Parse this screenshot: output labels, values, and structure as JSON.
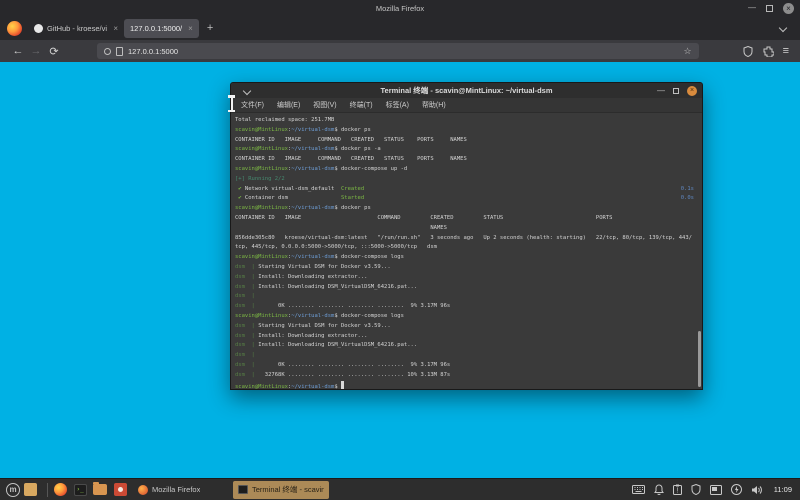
{
  "colors": {
    "desktop": "#00b1e4",
    "term-green": "#7cb944",
    "term-blue": "#6f9fd8",
    "accent-tan": "#ac8a57",
    "close-orange": "#d98b3d"
  },
  "browser": {
    "window_title": "Mozilla Firefox",
    "tabs": [
      {
        "label": "GitHub - kroese/virtual-dsm",
        "active": false
      },
      {
        "label": "127.0.0.1:5000/",
        "active": true
      }
    ],
    "new_tab": "+",
    "url": "127.0.0.1:5000",
    "star": "☆",
    "menu_glyph": "≡",
    "back": "←",
    "forward": "→",
    "reload": "⟳",
    "close_glyph": "×",
    "min_glyph": "—"
  },
  "terminal": {
    "title": "Terminal 终端 - scavin@MintLinux: ~/virtual-dsm",
    "menu": [
      "文件(F)",
      "编辑(E)",
      "视图(V)",
      "终端(T)",
      "标签(A)",
      "帮助(H)"
    ],
    "min_glyph": "—",
    "close_glyph": "×",
    "lines": [
      [
        [
          "fg",
          "Total reclaimed space: 251.7MB"
        ]
      ],
      [
        [
          "grn",
          "scavin@MintLinux"
        ],
        [
          "fg",
          ":"
        ],
        [
          "blu",
          "~/virtual-dsm"
        ],
        [
          "fg",
          "$ docker ps"
        ]
      ],
      [
        [
          "fg",
          "CONTAINER ID   IMAGE     COMMAND   CREATED   STATUS    PORTS     NAMES"
        ]
      ],
      [
        [
          "grn",
          "scavin@MintLinux"
        ],
        [
          "fg",
          ":"
        ],
        [
          "blu",
          "~/virtual-dsm"
        ],
        [
          "fg",
          "$ docker ps -a"
        ]
      ],
      [
        [
          "fg",
          "CONTAINER ID   IMAGE     COMMAND   CREATED   STATUS    PORTS     NAMES"
        ]
      ],
      [
        [
          "grn",
          "scavin@MintLinux"
        ],
        [
          "fg",
          ":"
        ],
        [
          "blu",
          "~/virtual-dsm"
        ],
        [
          "fg",
          "$ docker-compose up -d"
        ]
      ],
      [
        [
          "run",
          "[+] Running 2/2"
        ]
      ],
      [
        [
          "time",
          "0.1s"
        ],
        [
          "grn",
          " ✔"
        ],
        [
          "fg",
          " Network virtual-dsm_default  "
        ],
        [
          "grn",
          "Created"
        ]
      ],
      [
        [
          "time",
          "0.0s"
        ],
        [
          "grn",
          " ✔"
        ],
        [
          "fg",
          " Container dsm                "
        ],
        [
          "grn",
          "Started"
        ]
      ],
      [
        [
          "grn",
          "scavin@MintLinux"
        ],
        [
          "fg",
          ":"
        ],
        [
          "blu",
          "~/virtual-dsm"
        ],
        [
          "fg",
          "$ docker ps"
        ]
      ],
      [
        [
          "fg",
          "CONTAINER ID   IMAGE                       COMMAND         CREATED         STATUS                            PORTS"
        ]
      ],
      [
        [
          "fg",
          "                                                           NAMES"
        ]
      ],
      [
        [
          "fg",
          "856dde305c80   kroese/virtual-dsm:latest   \"/run/run.sh\"   3 seconds ago   Up 2 seconds (health: starting)   22/tcp, 80/tcp, 139/tcp, 443/"
        ]
      ],
      [
        [
          "fg",
          "tcp, 445/tcp, 0.0.0.0:5000->5000/tcp, :::5000->5000/tcp   dsm"
        ]
      ],
      [
        [
          "grn",
          "scavin@MintLinux"
        ],
        [
          "fg",
          ":"
        ],
        [
          "blu",
          "~/virtual-dsm"
        ],
        [
          "fg",
          "$ docker-compose logs"
        ]
      ],
      [
        [
          "svc",
          "dsm  | "
        ],
        [
          "fg",
          "Starting Virtual DSM for Docker v3.59..."
        ]
      ],
      [
        [
          "svc",
          "dsm  | "
        ],
        [
          "fg",
          "Install: Downloading extractor..."
        ]
      ],
      [
        [
          "svc",
          "dsm  | "
        ],
        [
          "fg",
          "Install: Downloading DSM_VirtualDSM_64216.pat..."
        ]
      ],
      [
        [
          "svc",
          "dsm  |"
        ]
      ],
      [
        [
          "svc",
          "dsm  | "
        ],
        [
          "fg",
          "      0K ........ ........ ........ ........  9% 3.17M 96s"
        ]
      ],
      [
        [
          "grn",
          "scavin@MintLinux"
        ],
        [
          "fg",
          ":"
        ],
        [
          "blu",
          "~/virtual-dsm"
        ],
        [
          "fg",
          "$ docker-compose logs"
        ]
      ],
      [
        [
          "svc",
          "dsm  | "
        ],
        [
          "fg",
          "Starting Virtual DSM for Docker v3.59..."
        ]
      ],
      [
        [
          "svc",
          "dsm  | "
        ],
        [
          "fg",
          "Install: Downloading extractor..."
        ]
      ],
      [
        [
          "svc",
          "dsm  | "
        ],
        [
          "fg",
          "Install: Downloading DSM_VirtualDSM_64216.pat..."
        ]
      ],
      [
        [
          "svc",
          "dsm  |"
        ]
      ],
      [
        [
          "svc",
          "dsm  | "
        ],
        [
          "fg",
          "      0K ........ ........ ........ ........  9% 3.17M 96s"
        ]
      ],
      [
        [
          "svc",
          "dsm  | "
        ],
        [
          "fg",
          "  32768K ........ ........ ........ ........ 10% 3.13M 87s"
        ]
      ],
      [
        [
          "grn",
          "scavin@MintLinux"
        ],
        [
          "fg",
          ":"
        ],
        [
          "blu",
          "~/virtual-dsm"
        ],
        [
          "fg",
          "$ "
        ],
        [
          "cursor",
          ""
        ]
      ]
    ]
  },
  "taskbar": {
    "menu_glyph": "m",
    "windows": [
      {
        "label": "Mozilla Firefox",
        "active": false
      },
      {
        "label": "Terminal 终端 - scavin@Mi...",
        "active": true
      }
    ],
    "clock": "11:09"
  }
}
